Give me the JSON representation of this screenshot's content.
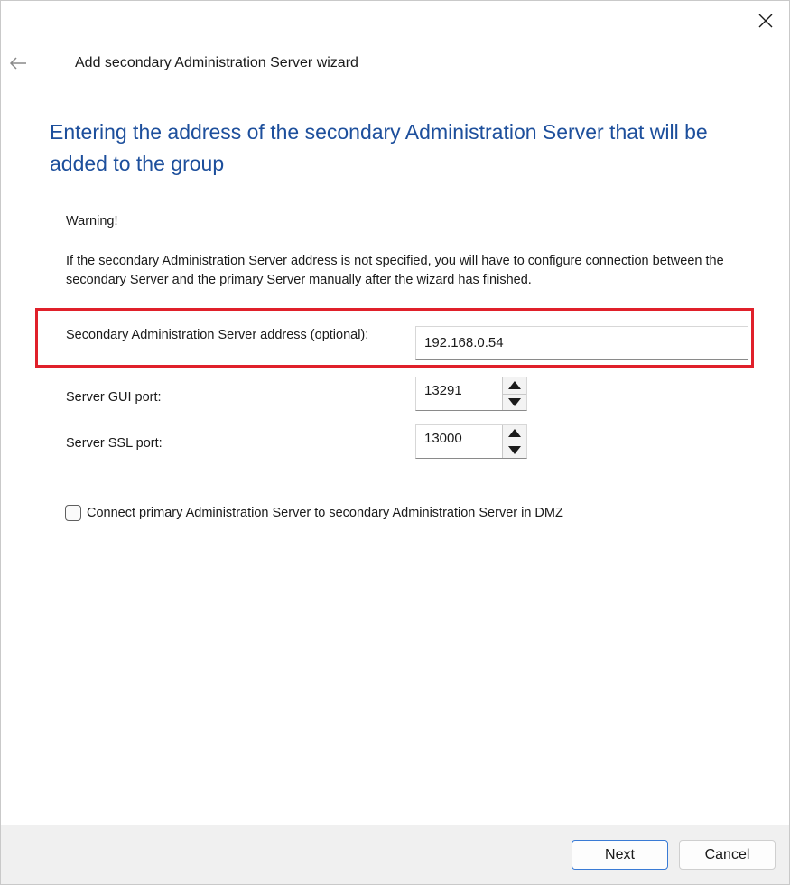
{
  "window": {
    "title": "Add secondary Administration Server wizard",
    "icons": {
      "close": "close-icon",
      "back": "arrow-left-icon"
    }
  },
  "page": {
    "heading": "Entering the address of the secondary Administration Server that will be added to the group",
    "warning_title": "Warning!",
    "warning_text": "If the secondary Administration Server address is not specified, you will have to configure connection between the secondary Server and the primary Server manually after the wizard has finished."
  },
  "address": {
    "label": "Secondary Administration Server address (optional):",
    "value": "192.168.0.54"
  },
  "gui_port": {
    "label": "Server GUI port:",
    "value": "13291"
  },
  "ssl_port": {
    "label": "Server SSL port:",
    "value": "13000"
  },
  "dmz": {
    "label": "Connect primary Administration Server to secondary Administration Server in DMZ",
    "checked": false
  },
  "footer": {
    "next_label": "Next",
    "cancel_label": "Cancel"
  },
  "colors": {
    "heading": "#1d4f9c",
    "highlight": "#e0202a",
    "footer_bg": "#f0f0f0",
    "primary_border": "#3a7bd5"
  }
}
